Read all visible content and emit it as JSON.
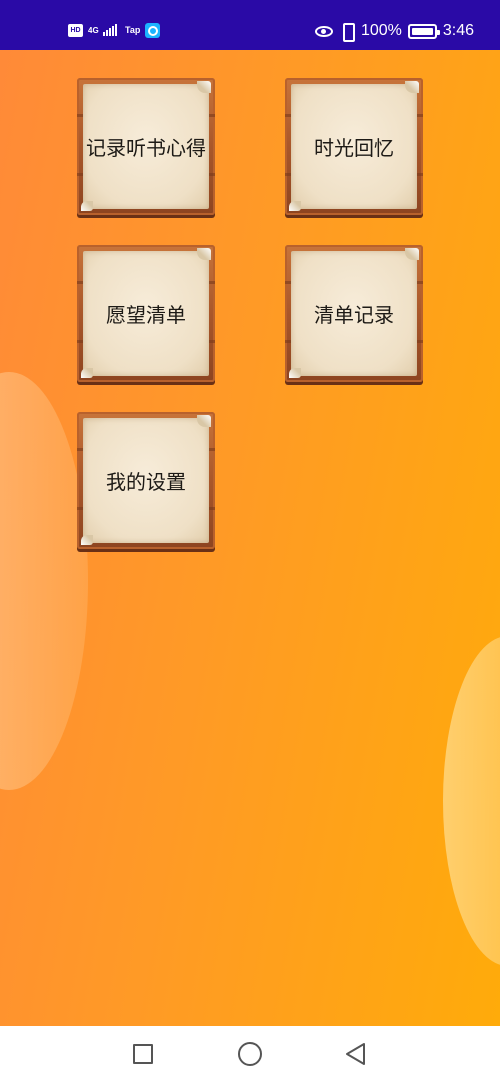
{
  "status_bar": {
    "hd_label": "HD",
    "network_type": "4G",
    "carrier": "Tap",
    "battery_percent": "100%",
    "time": "3:46",
    "icons": [
      "hd-icon",
      "signal-icon",
      "app-notification-icon",
      "eye-icon",
      "vibrate-icon",
      "battery-icon"
    ]
  },
  "menu": {
    "items": [
      {
        "label": "记录听书心得"
      },
      {
        "label": "时光回忆"
      },
      {
        "label": "愿望清单"
      },
      {
        "label": "清单记录"
      },
      {
        "label": "我的设置"
      }
    ]
  },
  "nav_bar": {
    "icons": [
      "recent-apps-icon",
      "home-icon",
      "back-icon"
    ]
  },
  "colors": {
    "status_bar_bg": "#2a0aa6",
    "background_start": "#ff8a38",
    "background_end": "#ffab0a",
    "tile_frame": "#a9572a",
    "tile_paper": "#f3e6cf",
    "label_text": "#1d1a16"
  }
}
